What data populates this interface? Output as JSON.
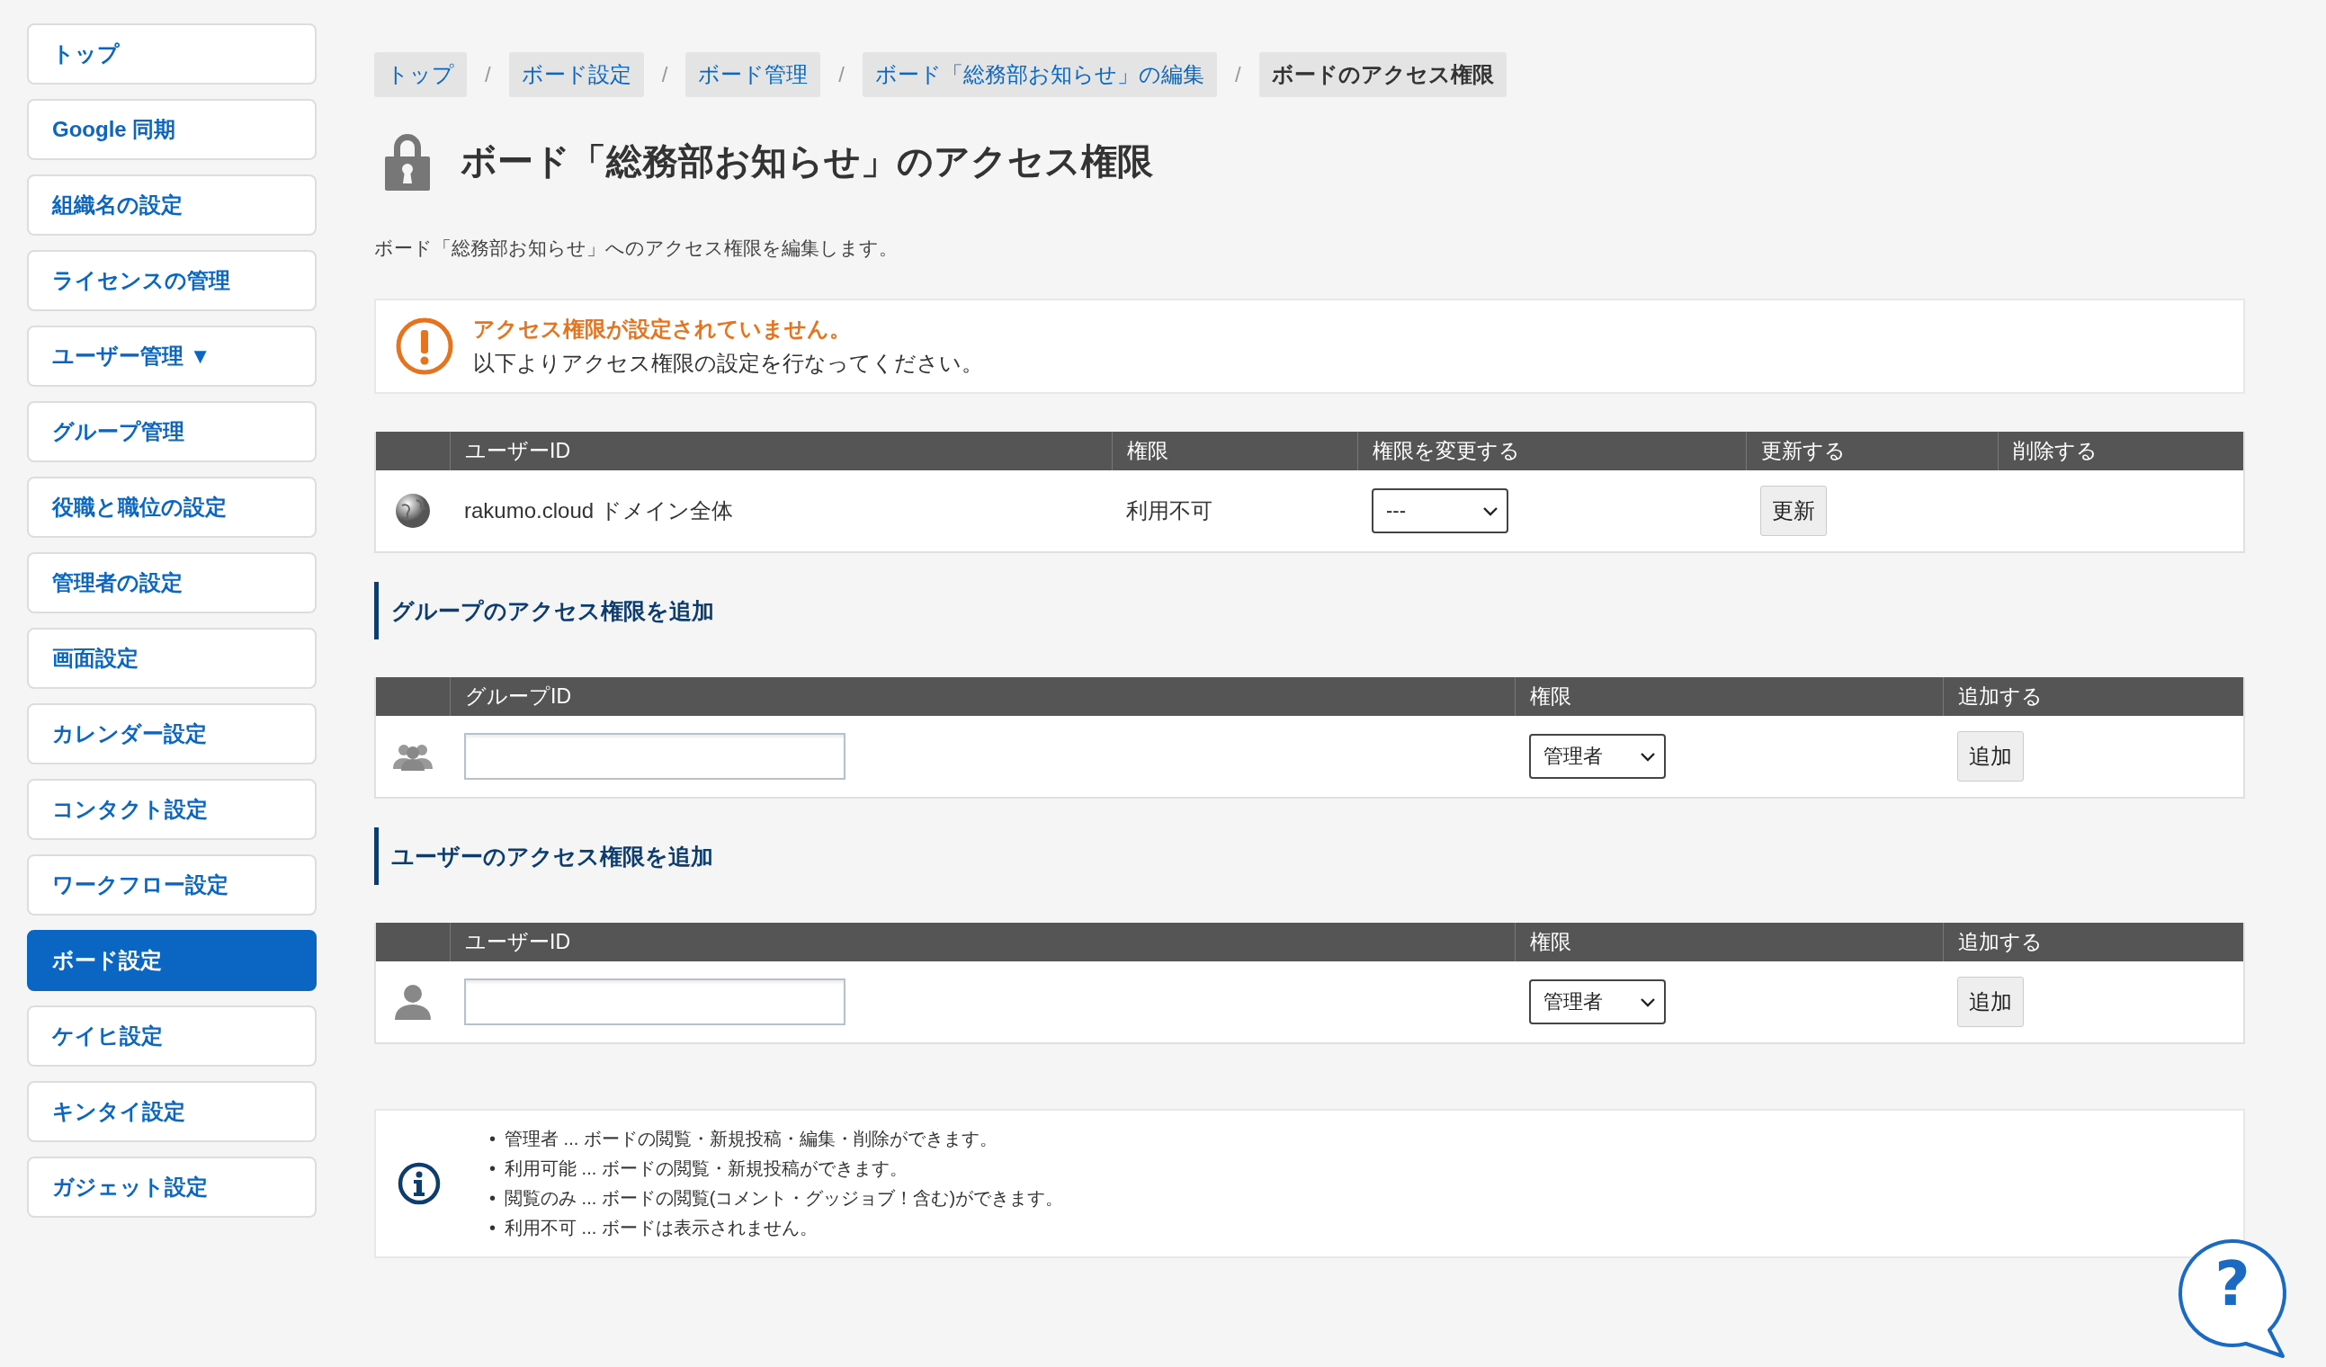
{
  "sidebar": {
    "items": [
      {
        "label": "トップ",
        "selected": false
      },
      {
        "label": "Google 同期",
        "selected": false
      },
      {
        "label": "組織名の設定",
        "selected": false
      },
      {
        "label": "ライセンスの管理",
        "selected": false
      },
      {
        "label": "ユーザー管理 ▼",
        "selected": false
      },
      {
        "label": "グループ管理",
        "selected": false
      },
      {
        "label": "役職と職位の設定",
        "selected": false
      },
      {
        "label": "管理者の設定",
        "selected": false
      },
      {
        "label": "画面設定",
        "selected": false
      },
      {
        "label": "カレンダー設定",
        "selected": false
      },
      {
        "label": "コンタクト設定",
        "selected": false
      },
      {
        "label": "ワークフロー設定",
        "selected": false
      },
      {
        "label": "ボード設定",
        "selected": true
      },
      {
        "label": "ケイヒ設定",
        "selected": false
      },
      {
        "label": "キンタイ設定",
        "selected": false
      },
      {
        "label": "ガジェット設定",
        "selected": false
      }
    ]
  },
  "breadcrumb": [
    {
      "label": "トップ",
      "selected": false
    },
    {
      "label": "ボード設定",
      "selected": false
    },
    {
      "label": "ボード管理",
      "selected": false
    },
    {
      "label": "ボード「総務部お知らせ」の編集",
      "selected": false
    },
    {
      "label": "ボードのアクセス権限",
      "selected": true
    }
  ],
  "breadcrumb_separator": "/",
  "page_title": "ボード「総務部お知らせ」のアクセス権限",
  "description": "ボード「総務部お知らせ」へのアクセス権限を編集します。",
  "alert": {
    "title": "アクセス権限が設定されていません。",
    "message": "以下よりアクセス権限の設定を行なってください。"
  },
  "sections": [
    {
      "kind": "domain",
      "columns": [
        "ユーザーID",
        "権限",
        "権限を変更する",
        "更新する",
        "削除する"
      ],
      "rows": [
        {
          "kind": "domain",
          "name": "rakumo.cloud ドメイン全体",
          "permission": "利用不可",
          "select_value": "---",
          "button": "更新"
        }
      ]
    },
    {
      "heading": "グループのアクセス権限を追加",
      "kind": "add",
      "columns": [
        "グループID",
        "権限",
        "追加する"
      ],
      "rows": [
        {
          "kind": "group",
          "select_value": "管理者",
          "button": "追加"
        }
      ]
    },
    {
      "heading": "ユーザーのアクセス権限を追加",
      "kind": "add",
      "columns": [
        "ユーザーID",
        "権限",
        "追加する"
      ],
      "rows": [
        {
          "kind": "user",
          "select_value": "管理者",
          "button": "追加"
        }
      ]
    }
  ],
  "info_bullet": "•",
  "info": [
    "管理者 ... ボードの閲覧・新規投稿・編集・削除ができます。",
    "利用可能 ... ボードの閲覧・新規投稿ができます。",
    "閲覧のみ ... ボードの閲覧(コメント・グッジョブ！含む)ができます。",
    "利用不可 ... ボードは表示されません。"
  ],
  "help_button": {
    "label": "?"
  }
}
